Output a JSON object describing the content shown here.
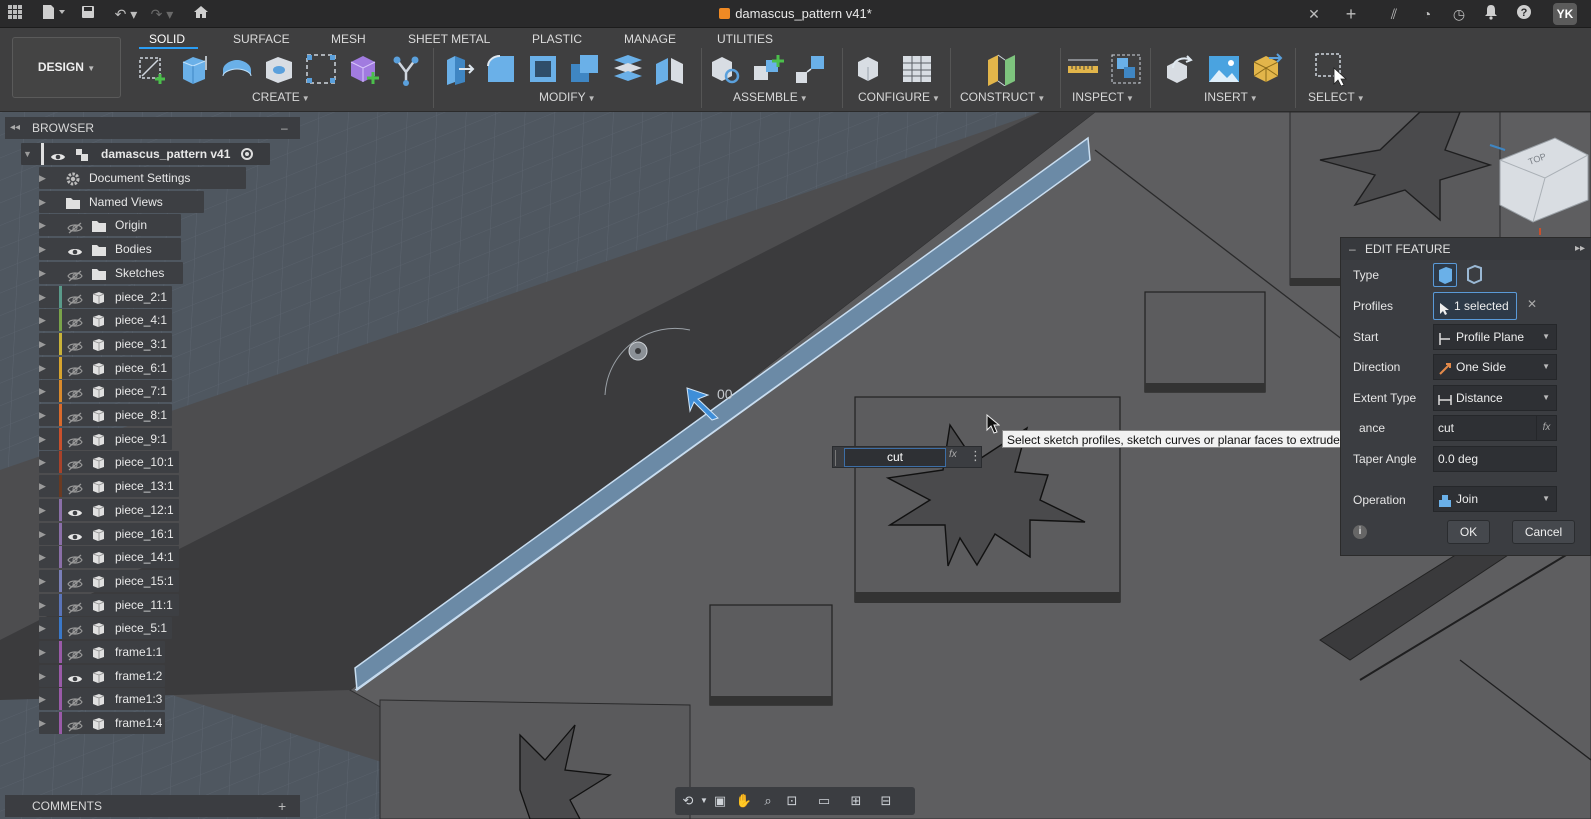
{
  "app": {
    "document_title": "damascus_pattern v41*",
    "user_initials": "YK"
  },
  "toolbar": {
    "workspace_label": "DESIGN",
    "tabs": [
      "SOLID",
      "SURFACE",
      "MESH",
      "SHEET METAL",
      "PLASTIC",
      "MANAGE",
      "UTILITIES"
    ],
    "active_tab": "SOLID",
    "groups": [
      "CREATE",
      "MODIFY",
      "ASSEMBLE",
      "CONFIGURE",
      "CONSTRUCT",
      "INSPECT",
      "INSERT",
      "SELECT"
    ]
  },
  "browser": {
    "title": "BROWSER",
    "root": "damascus_pattern v41",
    "items": [
      {
        "label": "Document Settings",
        "icon": "gear-icon"
      },
      {
        "label": "Named Views",
        "icon": "folder-icon"
      },
      {
        "label": "Origin",
        "icon": "folder-icon",
        "visible": false
      },
      {
        "label": "Bodies",
        "icon": "folder-icon",
        "visible": true
      },
      {
        "label": "Sketches",
        "icon": "folder-icon",
        "visible": false
      },
      {
        "label": "piece_2:1",
        "color": "#5a9a8a",
        "visible": false
      },
      {
        "label": "piece_4:1",
        "color": "#7aa34a",
        "visible": false
      },
      {
        "label": "piece_3:1",
        "color": "#c9b33a",
        "visible": false
      },
      {
        "label": "piece_6:1",
        "color": "#d7a42e",
        "visible": false
      },
      {
        "label": "piece_7:1",
        "color": "#d98a2c",
        "visible": false
      },
      {
        "label": "piece_8:1",
        "color": "#d96a2c",
        "visible": false
      },
      {
        "label": "piece_9:1",
        "color": "#c9502c",
        "visible": false
      },
      {
        "label": "piece_10:1",
        "color": "#a8422a",
        "visible": false
      },
      {
        "label": "piece_13:1",
        "color": "#6a3a22",
        "visible": false
      },
      {
        "label": "piece_12:1",
        "color": "#8a6fa8",
        "visible": true
      },
      {
        "label": "piece_16:1",
        "color": "#8a6fa8",
        "visible": true
      },
      {
        "label": "piece_14:1",
        "color": "#8a6fa8",
        "visible": false
      },
      {
        "label": "piece_15:1",
        "color": "#7a7fb8",
        "visible": false
      },
      {
        "label": "piece_11:1",
        "color": "#5a74b8",
        "visible": false
      },
      {
        "label": "piece_5:1",
        "color": "#3a78c9",
        "visible": false
      },
      {
        "label": "frame1:1",
        "color": "#9a5aa8",
        "visible": false
      },
      {
        "label": "frame1:2",
        "color": "#9a5aa8",
        "visible": true
      },
      {
        "label": "frame1:3",
        "color": "#9a5aa8",
        "visible": false
      },
      {
        "label": "frame1:4",
        "color": "#9a5aa8",
        "visible": false
      }
    ]
  },
  "comments": {
    "title": "COMMENTS"
  },
  "edit_feature": {
    "title": "EDIT FEATURE",
    "type_label": "Type",
    "profiles_label": "Profiles",
    "profiles_value": "1 selected",
    "start_label": "Start",
    "start_value": "Profile Plane",
    "direction_label": "Direction",
    "direction_value": "One Side",
    "extent_label": "Extent Type",
    "extent_value": "Distance",
    "distance_label": "ance",
    "distance_value": "cut",
    "taper_label": "Taper Angle",
    "taper_value": "0.0 deg",
    "operation_label": "Operation",
    "operation_value": "Join",
    "ok": "OK",
    "cancel": "Cancel"
  },
  "viewport": {
    "tooltip": "Select sketch profiles, sketch curves or planar faces to extrude",
    "distance_input": "cut",
    "dimension_text": "00",
    "viewcube_label": "TOP"
  }
}
